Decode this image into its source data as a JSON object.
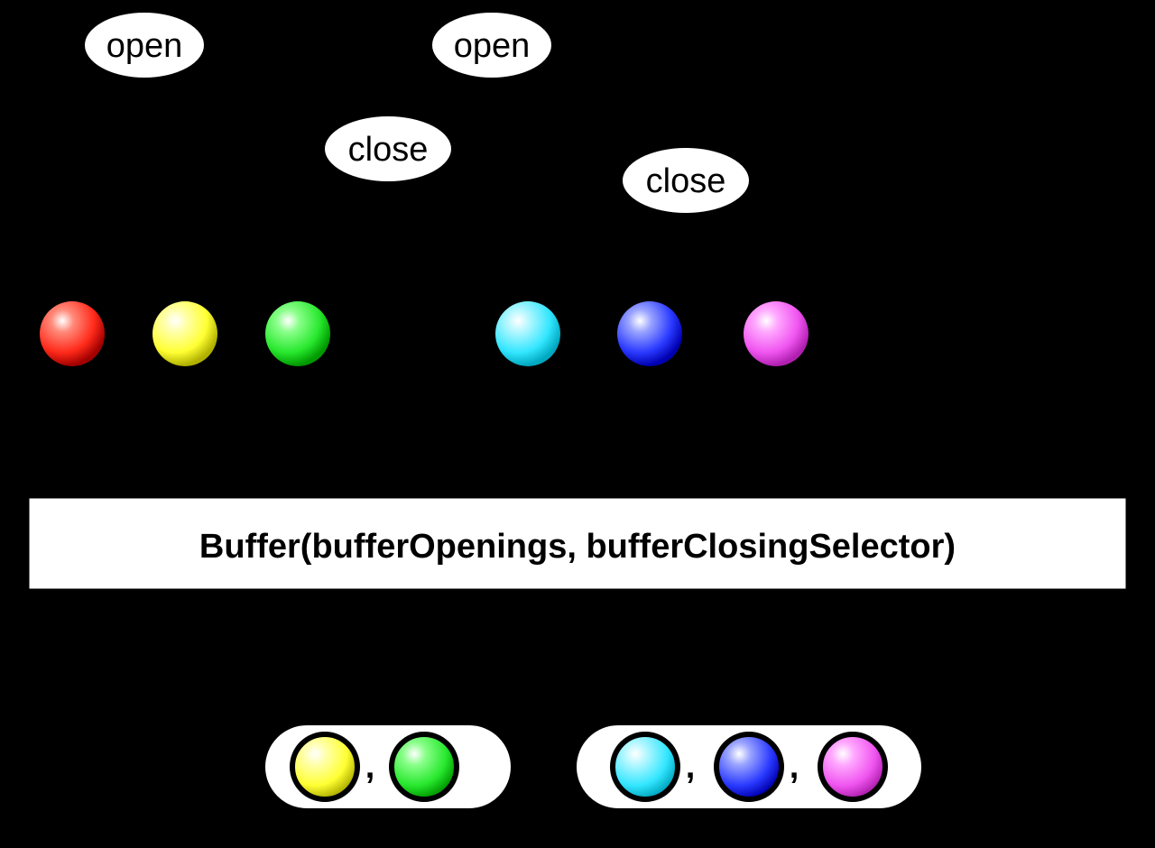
{
  "events": {
    "open1": "open",
    "open2": "open",
    "close1": "close",
    "close2": "close"
  },
  "operator": "Buffer(bufferOpenings, bufferClosingSelector)",
  "marbles": {
    "red": "#ff2a1a",
    "yellow": "#ffff33",
    "green": "#28e82e",
    "cyan": "#33e6ff",
    "blue": "#2a3aff",
    "magenta": "#f055f0"
  },
  "output_groups": [
    [
      "yellow",
      "green"
    ],
    [
      "cyan",
      "blue",
      "magenta"
    ]
  ]
}
